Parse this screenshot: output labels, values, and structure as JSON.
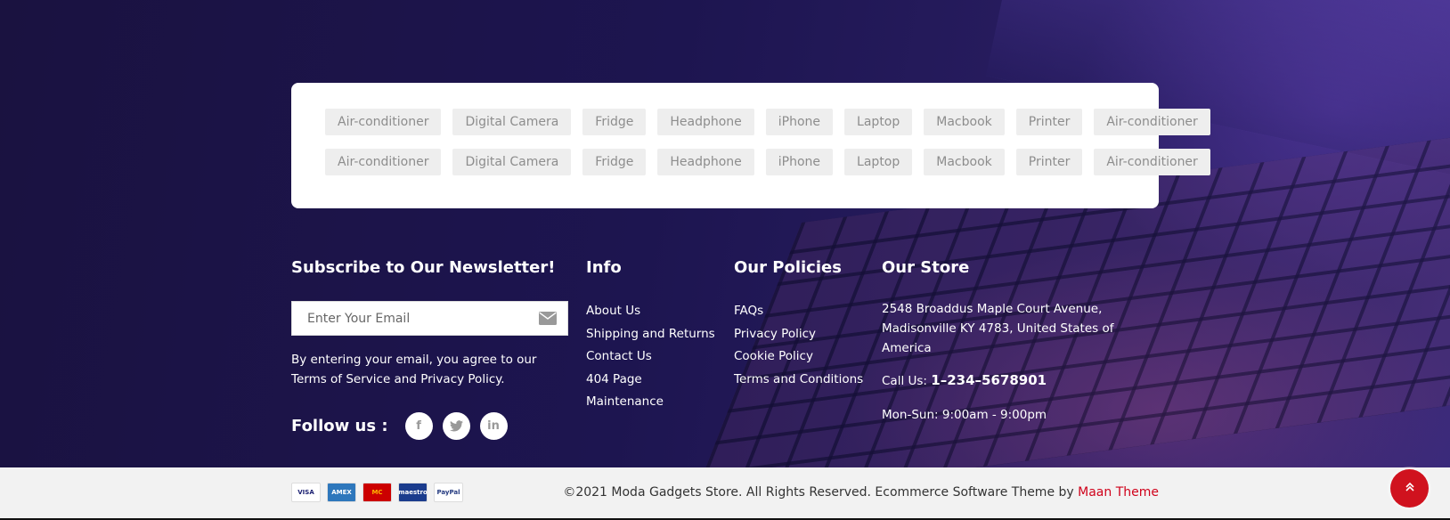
{
  "tags": {
    "row1": [
      "Air-conditioner",
      "Digital Camera",
      "Fridge",
      "Headphone",
      "iPhone",
      "Laptop",
      "Macbook",
      "Printer",
      "Air-conditioner"
    ],
    "row2": [
      "Air-conditioner",
      "Digital Camera",
      "Fridge",
      "Headphone",
      "iPhone",
      "Laptop",
      "Macbook",
      "Printer",
      "Air-conditioner"
    ]
  },
  "newsletter": {
    "title": "Subscribe to Our Newsletter!",
    "placeholder": "Enter Your Email",
    "agree_text": "By entering your email, you agree to our Terms of Service and Privacy Policy.",
    "follow_label": "Follow us :"
  },
  "social": [
    "facebook-icon",
    "twitter-icon",
    "linkedin-icon"
  ],
  "info": {
    "title": "Info",
    "links": [
      "About Us",
      "Shipping and Returns",
      "Contact Us",
      "404 Page",
      "Maintenance"
    ]
  },
  "policies": {
    "title": "Our Policies",
    "links": [
      "FAQs",
      "Privacy Policy",
      "Cookie Policy",
      "Terms and Conditions"
    ]
  },
  "store": {
    "title": "Our Store",
    "address": "2548 Broaddus Maple Court Avenue, Madisonville KY 4783, United States of America",
    "call_label": "Call Us:",
    "phone": "1–234–5678901",
    "hours": "Mon-Sun: 9:00am - 9:00pm"
  },
  "payments": [
    "VISA",
    "AMEX",
    "MC",
    "maestro",
    "PayPal"
  ],
  "footer": {
    "copyright": "©2021 Moda Gadgets Store. All Rights Reserved. Ecommerce Software Theme by ",
    "brand": "Maan Theme"
  },
  "colors": {
    "accent": "#d0121e",
    "bg_dark": "#1b1344",
    "footer_bg": "#f2f2f2"
  }
}
